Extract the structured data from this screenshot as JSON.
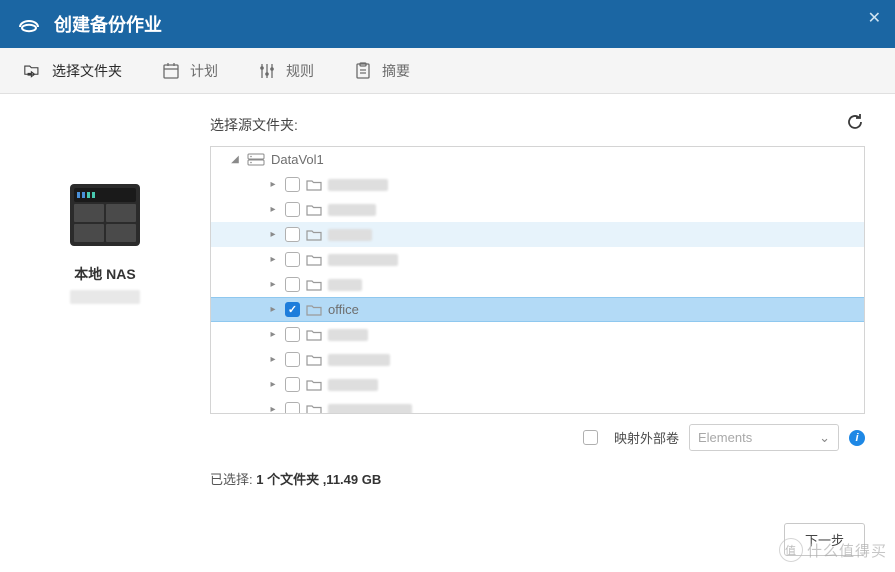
{
  "window": {
    "title": "创建备份作业"
  },
  "steps": [
    {
      "key": "select",
      "label": "选择文件夹",
      "active": true
    },
    {
      "key": "schedule",
      "label": "计划",
      "active": false
    },
    {
      "key": "rules",
      "label": "规则",
      "active": false
    },
    {
      "key": "summary",
      "label": "摘要",
      "active": false
    }
  ],
  "left": {
    "device_label": "本地 NAS"
  },
  "source": {
    "header": "选择源文件夹:",
    "volume": "DataVol1",
    "items": [
      {
        "name": "",
        "checked": false,
        "blur_w": 60
      },
      {
        "name": "",
        "checked": false,
        "blur_w": 48
      },
      {
        "name": "",
        "checked": false,
        "blur_w": 44,
        "hover": true
      },
      {
        "name": "",
        "checked": false,
        "blur_w": 70
      },
      {
        "name": "",
        "checked": false,
        "blur_w": 34
      },
      {
        "name": "office",
        "checked": true,
        "selected": true
      },
      {
        "name": "",
        "checked": false,
        "blur_w": 40
      },
      {
        "name": "",
        "checked": false,
        "blur_w": 62
      },
      {
        "name": "",
        "checked": false,
        "blur_w": 50
      },
      {
        "name": "",
        "checked": false,
        "blur_w": 84
      }
    ]
  },
  "external": {
    "checkbox_label": "映射外部卷",
    "select_value": "Elements"
  },
  "selected_summary": {
    "prefix": "已选择: ",
    "value": "1 个文件夹 ,11.49 GB"
  },
  "footer": {
    "next": "下一步"
  },
  "watermark": {
    "badge": "值",
    "text": "什么值得买"
  }
}
